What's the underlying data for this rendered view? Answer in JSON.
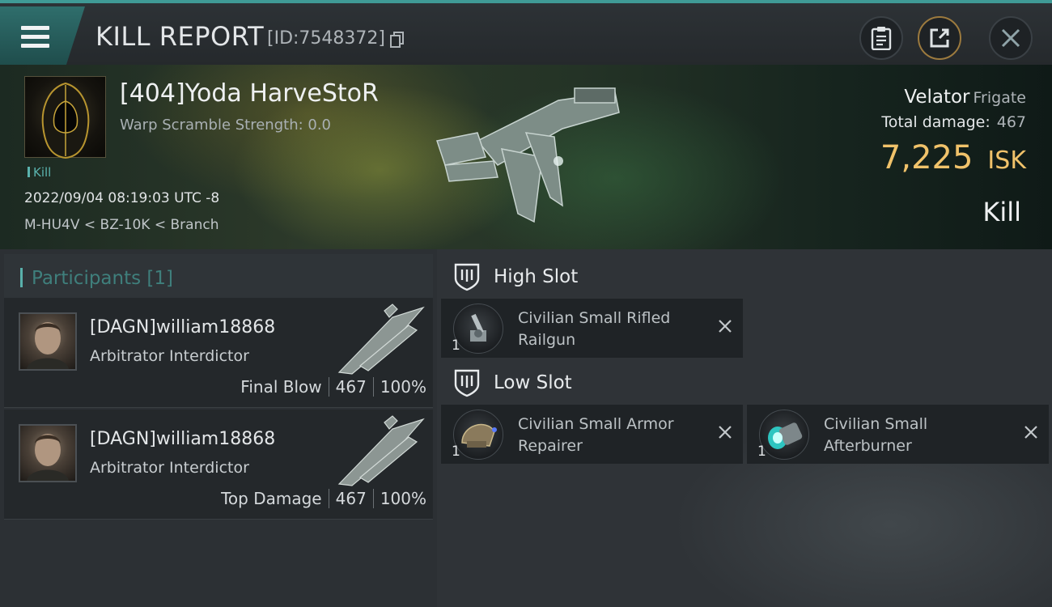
{
  "header": {
    "title": "KILL REPORT",
    "report_id": "[ID:7548372]"
  },
  "victim": {
    "name": "[404]Yoda HarveStoR",
    "warp_scramble": "Warp Scramble Strength: 0.0",
    "tag": "Kill",
    "datetime": "2022/09/04 08:19:03 UTC -8",
    "location": "M-HU4V < BZ-10K < Branch",
    "ship_name": "Velator",
    "ship_class": "Frigate",
    "total_damage_label": "Total damage:",
    "total_damage": "467",
    "isk_value": "7,225",
    "isk_unit": "ISK",
    "result": "Kill"
  },
  "participants": {
    "label": "Participants [1]",
    "rows": [
      {
        "name": "[DAGN]william18868",
        "ship": "Arbitrator Interdictor",
        "role": "Final Blow",
        "damage": "467",
        "percent": "100%"
      },
      {
        "name": "[DAGN]william18868",
        "ship": "Arbitrator Interdictor",
        "role": "Top Damage",
        "damage": "467",
        "percent": "100%"
      }
    ]
  },
  "fitting": {
    "high_slot_label": "High Slot",
    "low_slot_label": "Low Slot",
    "high": [
      {
        "qty": "1",
        "name": "Civilian Small Rifled Railgun"
      }
    ],
    "low": [
      {
        "qty": "1",
        "name": "Civilian Small Armor Repairer"
      },
      {
        "qty": "1",
        "name": "Civilian Small Afterburner"
      }
    ]
  },
  "colors": {
    "accent_teal": "#3f9a96",
    "isk_gold": "#f0c26a",
    "panel_dark": "#1f2326"
  }
}
